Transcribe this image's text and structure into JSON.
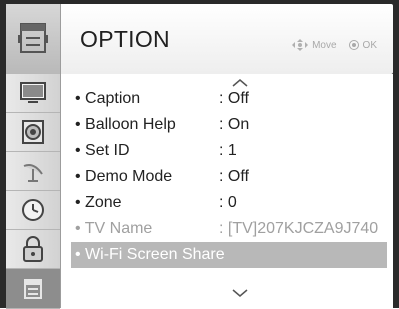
{
  "header": {
    "title": "OPTION",
    "move_label": "Move",
    "ok_label": "OK"
  },
  "sidebar": {
    "items": [
      {
        "icon": "picture-icon"
      },
      {
        "icon": "audio-icon"
      },
      {
        "icon": "satellite-icon"
      },
      {
        "icon": "clock-icon"
      },
      {
        "icon": "lock-icon"
      },
      {
        "icon": "option-icon",
        "active": true
      }
    ]
  },
  "menu": {
    "items": [
      {
        "label": "• Caption",
        "value": ": Off"
      },
      {
        "label": "• Balloon Help",
        "value": ": On"
      },
      {
        "label": "• Set ID",
        "value": ": 1"
      },
      {
        "label": "• Demo Mode",
        "value": ": Off"
      },
      {
        "label": "• Zone",
        "value": ": 0"
      },
      {
        "label": "• TV Name",
        "value": ": [TV]207KJCZA9J740",
        "disabled": true
      },
      {
        "label": "• Wi-Fi Screen Share",
        "value": "",
        "highlighted": true
      }
    ]
  }
}
